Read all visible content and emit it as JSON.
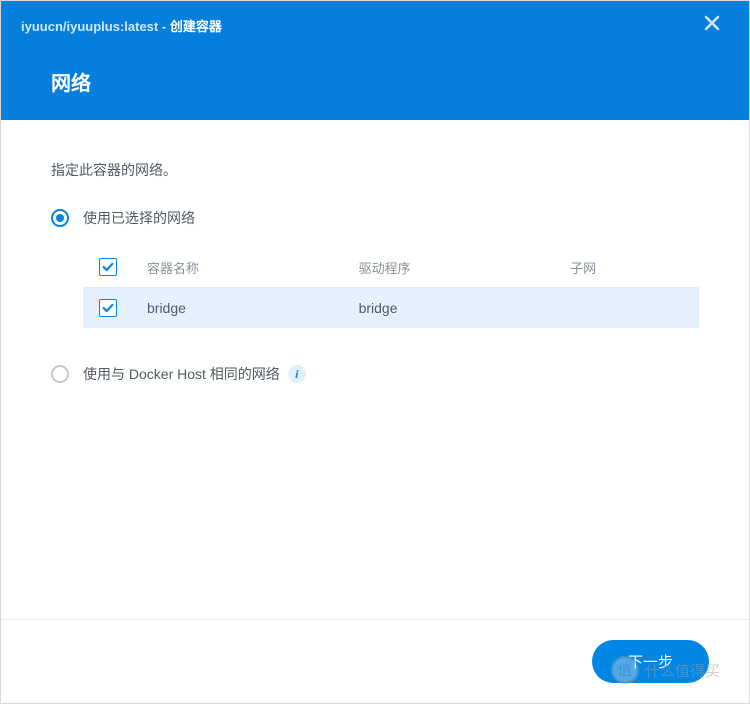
{
  "header": {
    "image_path": "iyuucn/iyuuplus:latest",
    "separator": " - ",
    "action": "创建容器",
    "page_title": "网络"
  },
  "content": {
    "description": "指定此容器的网络。",
    "option_selected": {
      "label": "使用已选择的网络"
    },
    "option_host": {
      "label": "使用与 Docker Host 相同的网络"
    },
    "table": {
      "headers": {
        "name": "容器名称",
        "driver": "驱动程序",
        "subnet": "子网"
      },
      "rows": [
        {
          "checked": true,
          "name": "bridge",
          "driver": "bridge",
          "subnet": ""
        }
      ]
    }
  },
  "footer": {
    "next_label": "下一步"
  },
  "watermark": {
    "badge": "值",
    "text": "什么值得买"
  }
}
